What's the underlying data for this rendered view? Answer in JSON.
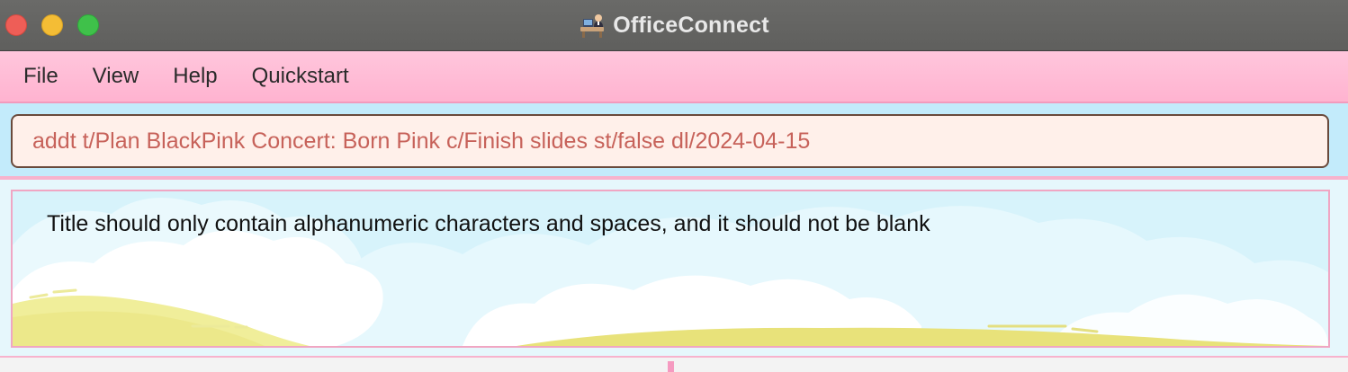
{
  "window": {
    "title": "OfficeConnect",
    "app_icon": "office-worker-icon"
  },
  "menu": {
    "items": [
      {
        "label": "File"
      },
      {
        "label": "View"
      },
      {
        "label": "Help"
      },
      {
        "label": "Quickstart"
      }
    ]
  },
  "command": {
    "value": "addt t/Plan BlackPink Concert: Born Pink c/Finish slides st/false dl/2024-04-15"
  },
  "result": {
    "message": "Title should only contain alphanumeric characters and spaces, and it should not be blank"
  },
  "colors": {
    "menu_bar": "#ffb3d0",
    "command_text": "#c7625a",
    "command_background": "#fff0ea",
    "result_border": "#f0a6c3"
  }
}
